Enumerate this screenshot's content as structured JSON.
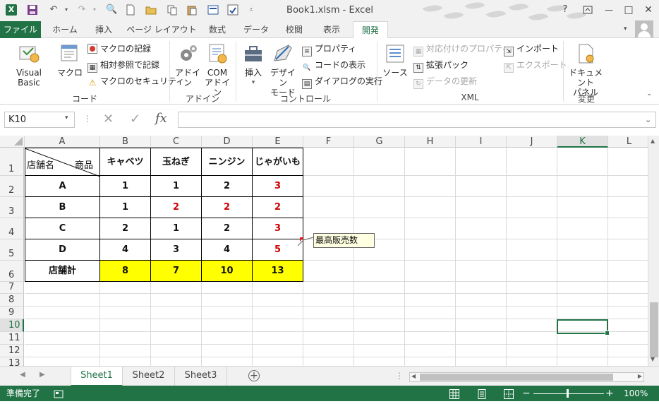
{
  "title_bar": {
    "title": "Book1.xlsm - Excel",
    "help_icon": "?",
    "minimize_icon": "—",
    "restore_icon": "□",
    "close_icon": "✕"
  },
  "quick_access": {
    "save_icon": "save-icon",
    "undo_icon": "undo-icon",
    "redo_icon": "redo-icon"
  },
  "ribbon_tabs": {
    "file": "ファイル",
    "home": "ホーム",
    "insert": "挿入",
    "page_layout": "ページ レイアウト",
    "formulas": "数式",
    "data": "データ",
    "review": "校閲",
    "view": "表示",
    "developer": "開発"
  },
  "ribbon": {
    "code_group": {
      "label": "コード",
      "visual_basic": "Visual Basic",
      "macro": "マクロ",
      "record_macro": "マクロの記録",
      "relative_ref": "相対参照で記録",
      "macro_security": "マクロのセキュリティ"
    },
    "addins_group": {
      "label": "アドイン",
      "addins": "アドイン",
      "com_addins_line1": "COM",
      "com_addins_line2": "アドイン"
    },
    "controls_group": {
      "label": "コントロール",
      "insert": "挿入",
      "design_mode_line1": "デザイン",
      "design_mode_line2": "モード",
      "properties": "プロパティ",
      "view_code": "コードの表示",
      "run_dialog": "ダイアログの実行"
    },
    "xml_group": {
      "label": "XML",
      "source": "ソース",
      "map_properties": "対応付けのプロパティ",
      "expansion_packs": "拡張パック",
      "refresh_data": "データの更新",
      "import": "インポート",
      "export": "エクスポート"
    },
    "modify_group": {
      "label": "変更",
      "doc_panel_line1": "ドキュメント",
      "doc_panel_line2": "パネル"
    }
  },
  "formula_bar": {
    "name_box": "K10",
    "cancel_icon": "✕",
    "enter_icon": "✓",
    "fx_label": "fx",
    "content": ""
  },
  "columns": [
    "A",
    "B",
    "C",
    "D",
    "E",
    "F",
    "G",
    "H",
    "I",
    "J",
    "K",
    "L"
  ],
  "rows": [
    "1",
    "2",
    "3",
    "4",
    "5",
    "6",
    "7",
    "8",
    "9",
    "10",
    "11",
    "12",
    "13"
  ],
  "selected_cell": {
    "column": "K",
    "row": "10"
  },
  "table": {
    "corner_left": "店舗名",
    "corner_right": "商品",
    "headers": [
      "キャベツ",
      "玉ねぎ",
      "ニンジン",
      "じゃがいも"
    ],
    "rows": [
      {
        "label": "A",
        "values": [
          "1",
          "1",
          "2",
          "3"
        ],
        "highlight": [
          false,
          false,
          false,
          true
        ]
      },
      {
        "label": "B",
        "values": [
          "1",
          "2",
          "2",
          "2"
        ],
        "highlight": [
          false,
          true,
          true,
          true
        ]
      },
      {
        "label": "C",
        "values": [
          "2",
          "1",
          "2",
          "3"
        ],
        "highlight": [
          false,
          false,
          false,
          true
        ]
      },
      {
        "label": "D",
        "values": [
          "4",
          "3",
          "4",
          "5"
        ],
        "highlight": [
          false,
          false,
          false,
          true
        ]
      }
    ],
    "total_label": "店舗計",
    "totals": [
      "8",
      "7",
      "10",
      "13"
    ]
  },
  "comment": {
    "text": "最高販売数",
    "attached_cell": "E4"
  },
  "sheet_tabs": [
    "Sheet1",
    "Sheet2",
    "Sheet3"
  ],
  "active_sheet": "Sheet1",
  "status": {
    "ready": "準備完了",
    "zoom": "100%",
    "zoom_minus": "−",
    "zoom_plus": "+"
  },
  "colors": {
    "accent": "#217346",
    "highlight_red": "#d00000",
    "total_fill": "#ffff00"
  }
}
